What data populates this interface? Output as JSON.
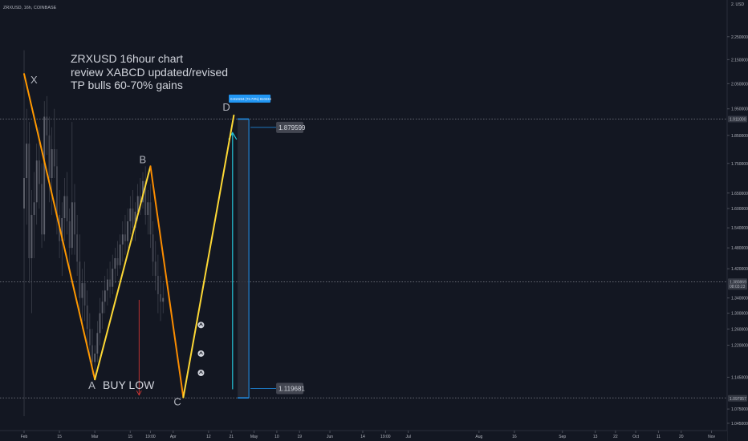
{
  "chart_data": {
    "type": "line",
    "symbol": "ZRXUSD, 16h, COINBASE",
    "currency": "USD",
    "annotation_lines": [
      "ZRXUSD 16hour chart",
      "review XABCD updated/revised",
      "TP bulls 60-70% gains"
    ],
    "buy_label": "BUY LOW",
    "ylim": [
      1.03,
      2.42
    ],
    "xlim": [
      0,
      275
    ],
    "y_ticks": [
      {
        "value": 2.25,
        "label": "2.250000"
      },
      {
        "value": 2.15,
        "label": "2.150000"
      },
      {
        "value": 2.05,
        "label": "2.050000"
      },
      {
        "value": 1.95,
        "label": "1.950000"
      },
      {
        "value": 1.85,
        "label": "1.850000"
      },
      {
        "value": 1.75,
        "label": "1.750000"
      },
      {
        "value": 1.65,
        "label": "1.650000"
      },
      {
        "value": 1.6,
        "label": "1.600000"
      },
      {
        "value": 1.54,
        "label": "1.540000"
      },
      {
        "value": 1.48,
        "label": "1.480000"
      },
      {
        "value": 1.42,
        "label": "1.420000"
      },
      {
        "value": 1.34,
        "label": "1.340000"
      },
      {
        "value": 1.3,
        "label": "1.300000"
      },
      {
        "value": 1.26,
        "label": "1.260000"
      },
      {
        "value": 1.22,
        "label": "1.220000"
      },
      {
        "value": 1.145,
        "label": "1.145000"
      },
      {
        "value": 1.075,
        "label": "1.075000"
      },
      {
        "value": 1.045,
        "label": "1.045000"
      }
    ],
    "top_tick": {
      "value": 2.4,
      "label": "2. USD"
    },
    "x_ticks": [
      {
        "x": 0,
        "label": "Feb"
      },
      {
        "x": 14,
        "label": "15"
      },
      {
        "x": 28,
        "label": "Mar"
      },
      {
        "x": 42,
        "label": "15"
      },
      {
        "x": 50,
        "label": "19:00"
      },
      {
        "x": 59,
        "label": "Apr"
      },
      {
        "x": 73,
        "label": "12"
      },
      {
        "x": 82,
        "label": "21"
      },
      {
        "x": 91,
        "label": "May"
      },
      {
        "x": 100,
        "label": "10"
      },
      {
        "x": 109,
        "label": "19"
      },
      {
        "x": 121,
        "label": "Jun"
      },
      {
        "x": 134,
        "label": "14"
      },
      {
        "x": 143,
        "label": "19:00"
      },
      {
        "x": 152,
        "label": "Jul"
      },
      {
        "x": 180,
        "label": "Aug"
      },
      {
        "x": 194,
        "label": "16"
      },
      {
        "x": 213,
        "label": "Sep"
      },
      {
        "x": 226,
        "label": "13"
      },
      {
        "x": 234,
        "label": "22"
      },
      {
        "x": 242,
        "label": "Oct"
      },
      {
        "x": 251,
        "label": "11"
      },
      {
        "x": 260,
        "label": "20"
      },
      {
        "x": 272,
        "label": "Nov"
      }
    ],
    "pattern_points": [
      {
        "label": "X",
        "x": 0,
        "y": 2.09
      },
      {
        "label": "A",
        "x": 28,
        "y": 1.14
      },
      {
        "label": "B",
        "x": 50,
        "y": 1.74
      },
      {
        "label": "C",
        "x": 63,
        "y": 1.1
      },
      {
        "label": "D",
        "x": 83,
        "y": 1.925
      }
    ],
    "price_labels": [
      {
        "label": "1.911000",
        "value": 1.911
      },
      {
        "label": "1.380869",
        "value": 1.384
      },
      {
        "label": "08:03:23",
        "value": 1.371
      },
      {
        "label": "1.097957",
        "value": 1.098
      }
    ],
    "measure_target": {
      "label": "1.879599",
      "value": 1.879599
    },
    "measure_base": {
      "label": "1.119681",
      "value": 1.119681
    },
    "measure_top_label": "0.810234 (73.73%) 810234",
    "horizontal_levels": [
      1.911,
      1.384,
      1.099
    ],
    "candles": [
      {
        "x": 0,
        "o": 1.6,
        "h": 2.19,
        "l": 1.06,
        "c": 1.7
      },
      {
        "x": 1,
        "o": 1.7,
        "h": 1.95,
        "l": 1.55,
        "c": 1.82
      },
      {
        "x": 2,
        "o": 1.82,
        "h": 1.9,
        "l": 1.38,
        "c": 1.45
      },
      {
        "x": 3,
        "o": 1.45,
        "h": 1.66,
        "l": 1.3,
        "c": 1.58
      },
      {
        "x": 4,
        "o": 1.58,
        "h": 1.72,
        "l": 1.45,
        "c": 1.62
      },
      {
        "x": 5,
        "o": 1.62,
        "h": 1.82,
        "l": 1.55,
        "c": 1.76
      },
      {
        "x": 6,
        "o": 1.76,
        "h": 1.88,
        "l": 1.6,
        "c": 1.68
      },
      {
        "x": 7,
        "o": 1.68,
        "h": 1.75,
        "l": 1.48,
        "c": 1.52
      },
      {
        "x": 8,
        "o": 1.52,
        "h": 1.98,
        "l": 1.5,
        "c": 1.92
      },
      {
        "x": 9,
        "o": 1.92,
        "h": 2.0,
        "l": 1.78,
        "c": 1.85
      },
      {
        "x": 10,
        "o": 1.85,
        "h": 1.92,
        "l": 1.62,
        "c": 1.7
      },
      {
        "x": 11,
        "o": 1.7,
        "h": 1.88,
        "l": 1.58,
        "c": 1.8
      },
      {
        "x": 12,
        "o": 1.8,
        "h": 1.95,
        "l": 1.7,
        "c": 1.74
      },
      {
        "x": 13,
        "o": 1.74,
        "h": 1.8,
        "l": 1.52,
        "c": 1.58
      },
      {
        "x": 14,
        "o": 1.58,
        "h": 1.66,
        "l": 1.45,
        "c": 1.5
      },
      {
        "x": 15,
        "o": 1.5,
        "h": 1.62,
        "l": 1.4,
        "c": 1.57
      },
      {
        "x": 16,
        "o": 1.57,
        "h": 1.7,
        "l": 1.5,
        "c": 1.64
      },
      {
        "x": 17,
        "o": 1.64,
        "h": 1.72,
        "l": 1.52,
        "c": 1.56
      },
      {
        "x": 18,
        "o": 1.56,
        "h": 1.6,
        "l": 1.42,
        "c": 1.48
      },
      {
        "x": 19,
        "o": 1.48,
        "h": 1.9,
        "l": 1.46,
        "c": 1.62
      },
      {
        "x": 20,
        "o": 1.62,
        "h": 1.68,
        "l": 1.46,
        "c": 1.52
      },
      {
        "x": 21,
        "o": 1.52,
        "h": 1.58,
        "l": 1.4,
        "c": 1.44
      },
      {
        "x": 22,
        "o": 1.44,
        "h": 1.52,
        "l": 1.3,
        "c": 1.34
      },
      {
        "x": 23,
        "o": 1.34,
        "h": 1.42,
        "l": 1.26,
        "c": 1.38
      },
      {
        "x": 24,
        "o": 1.38,
        "h": 1.44,
        "l": 1.28,
        "c": 1.32
      },
      {
        "x": 25,
        "o": 1.32,
        "h": 1.36,
        "l": 1.22,
        "c": 1.26
      },
      {
        "x": 26,
        "o": 1.26,
        "h": 1.3,
        "l": 1.18,
        "c": 1.22
      },
      {
        "x": 27,
        "o": 1.22,
        "h": 1.26,
        "l": 1.15,
        "c": 1.18
      },
      {
        "x": 28,
        "o": 1.18,
        "h": 1.22,
        "l": 1.14,
        "c": 1.2
      },
      {
        "x": 29,
        "o": 1.2,
        "h": 1.28,
        "l": 1.18,
        "c": 1.25
      },
      {
        "x": 30,
        "o": 1.25,
        "h": 1.34,
        "l": 1.22,
        "c": 1.3
      },
      {
        "x": 31,
        "o": 1.3,
        "h": 1.36,
        "l": 1.26,
        "c": 1.33
      },
      {
        "x": 32,
        "o": 1.33,
        "h": 1.4,
        "l": 1.3,
        "c": 1.36
      },
      {
        "x": 33,
        "o": 1.36,
        "h": 1.42,
        "l": 1.32,
        "c": 1.39
      },
      {
        "x": 34,
        "o": 1.39,
        "h": 1.44,
        "l": 1.34,
        "c": 1.37
      },
      {
        "x": 35,
        "o": 1.37,
        "h": 1.46,
        "l": 1.35,
        "c": 1.42
      },
      {
        "x": 36,
        "o": 1.42,
        "h": 1.48,
        "l": 1.38,
        "c": 1.45
      },
      {
        "x": 37,
        "o": 1.45,
        "h": 1.5,
        "l": 1.4,
        "c": 1.43
      },
      {
        "x": 38,
        "o": 1.43,
        "h": 1.52,
        "l": 1.42,
        "c": 1.49
      },
      {
        "x": 39,
        "o": 1.49,
        "h": 1.56,
        "l": 1.44,
        "c": 1.52
      },
      {
        "x": 40,
        "o": 1.52,
        "h": 1.58,
        "l": 1.46,
        "c": 1.5
      },
      {
        "x": 41,
        "o": 1.5,
        "h": 1.6,
        "l": 1.48,
        "c": 1.56
      },
      {
        "x": 42,
        "o": 1.56,
        "h": 1.64,
        "l": 1.52,
        "c": 1.6
      },
      {
        "x": 43,
        "o": 1.6,
        "h": 1.66,
        "l": 1.5,
        "c": 1.54
      },
      {
        "x": 44,
        "o": 1.54,
        "h": 1.62,
        "l": 1.5,
        "c": 1.59
      },
      {
        "x": 45,
        "o": 1.59,
        "h": 1.68,
        "l": 1.56,
        "c": 1.64
      },
      {
        "x": 46,
        "o": 1.64,
        "h": 1.7,
        "l": 1.58,
        "c": 1.62
      },
      {
        "x": 47,
        "o": 1.62,
        "h": 1.72,
        "l": 1.6,
        "c": 1.69
      },
      {
        "x": 48,
        "o": 1.69,
        "h": 1.74,
        "l": 1.55,
        "c": 1.58
      },
      {
        "x": 49,
        "o": 1.58,
        "h": 1.66,
        "l": 1.52,
        "c": 1.62
      },
      {
        "x": 50,
        "o": 1.62,
        "h": 1.68,
        "l": 1.48,
        "c": 1.52
      },
      {
        "x": 51,
        "o": 1.52,
        "h": 1.56,
        "l": 1.4,
        "c": 1.44
      },
      {
        "x": 52,
        "o": 1.44,
        "h": 1.5,
        "l": 1.36,
        "c": 1.4
      },
      {
        "x": 53,
        "o": 1.4,
        "h": 1.46,
        "l": 1.3,
        "c": 1.35
      },
      {
        "x": 54,
        "o": 1.35,
        "h": 1.4,
        "l": 1.28,
        "c": 1.33
      },
      {
        "x": 55,
        "o": 1.33,
        "h": 1.38,
        "l": 1.3,
        "c": 1.34
      }
    ]
  }
}
